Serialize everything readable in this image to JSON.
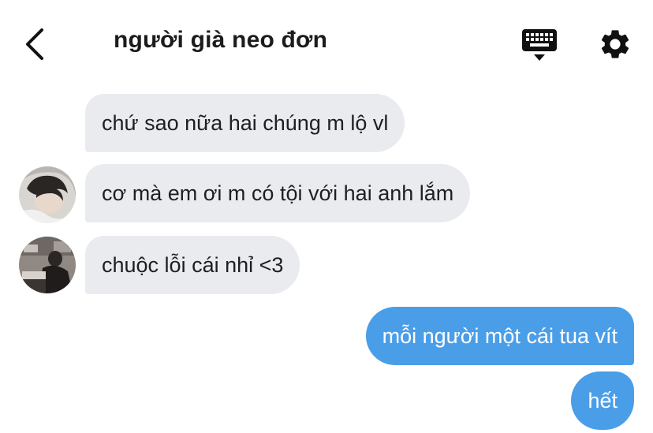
{
  "header": {
    "title": "người già neo đơn",
    "back_icon": "chevron-left-icon",
    "keyboard_icon": "keyboard-icon",
    "settings_icon": "gear-icon"
  },
  "messages": [
    {
      "side": "incoming",
      "text": "chứ sao nữa hai chúng m lộ vl"
    },
    {
      "side": "incoming",
      "text": "cơ mà em ơi m có tội với hai anh lắm"
    },
    {
      "side": "incoming",
      "text": "chuộc lỗi cái nhỉ <3"
    },
    {
      "side": "outgoing",
      "text": "mỗi người một cái tua vít"
    },
    {
      "side": "outgoing",
      "text": "hết"
    }
  ],
  "colors": {
    "incoming_bubble": "#e9ebef",
    "outgoing_bubble": "#4a9ee8",
    "icon": "#111111"
  }
}
